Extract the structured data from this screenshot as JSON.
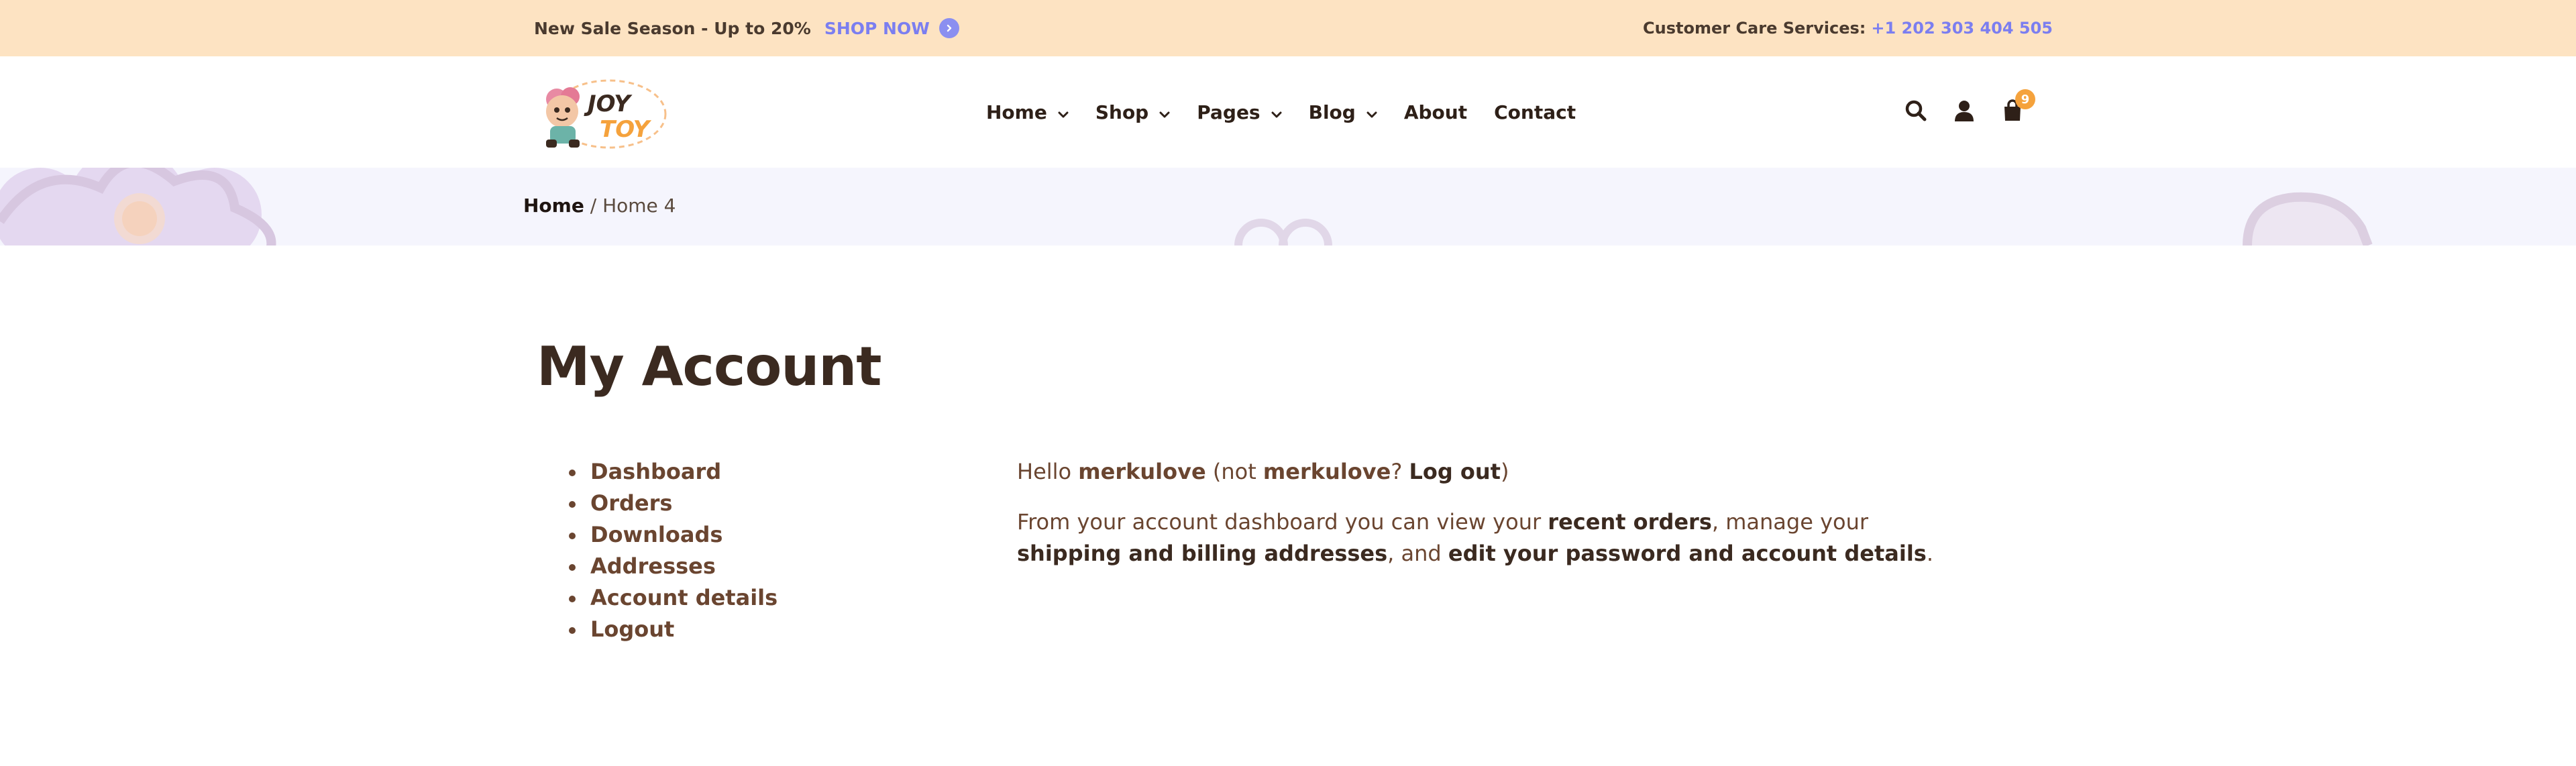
{
  "topbar": {
    "promo_text": "New Sale Season - Up to 20%",
    "shop_now_label": "SHOP NOW",
    "care_label": "Customer Care Services:",
    "phone": "+1 202 303 404 505"
  },
  "logo": {
    "line1": "JOY",
    "line2": "TOY"
  },
  "nav": {
    "items": [
      {
        "label": "Home"
      },
      {
        "label": "Shop"
      },
      {
        "label": "Pages"
      },
      {
        "label": "Blog"
      },
      {
        "label": "About"
      },
      {
        "label": "Contact"
      }
    ]
  },
  "header_icons": {
    "cart_count": "9"
  },
  "breadcrumb": {
    "home": "Home",
    "separator": " / ",
    "current": "Home 4"
  },
  "page": {
    "title": "My Account"
  },
  "account_nav": {
    "items": [
      {
        "label": "Dashboard"
      },
      {
        "label": "Orders"
      },
      {
        "label": "Downloads"
      },
      {
        "label": "Addresses"
      },
      {
        "label": "Account details"
      },
      {
        "label": "Logout"
      }
    ]
  },
  "dashboard": {
    "hello_prefix": "Hello ",
    "username": "merkulove",
    "not_prefix": " (not ",
    "not_user": "merkulove",
    "not_suffix": "? ",
    "logout_link": "Log out",
    "close_paren": ")",
    "intro_text": "From your account dashboard you can view your ",
    "recent_orders_link": "recent orders",
    "mid_text": ", manage your ",
    "addresses_link": "shipping and billing addresses",
    "and_text": ", and ",
    "edit_link": "edit your password and account details",
    "end_text": "."
  },
  "colors": {
    "topbar_bg": "#fde3c2",
    "accent_purple": "#7b7ef0",
    "badge_orange": "#f5a23c",
    "band_bg": "#f5f5fd",
    "text_brown": "#6a4530"
  }
}
